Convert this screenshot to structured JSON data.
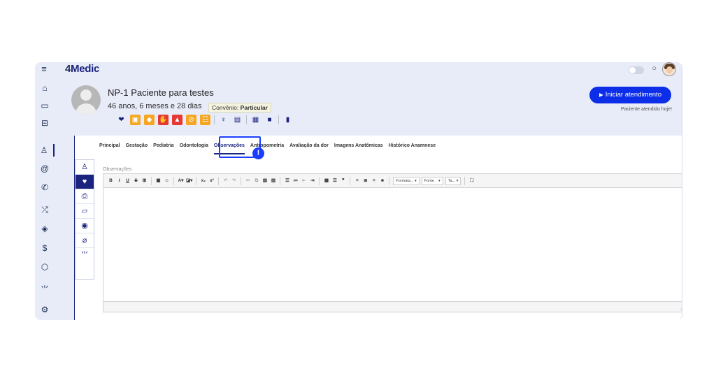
{
  "app": {
    "logo": {
      "four": "4",
      "rest": "Medic"
    }
  },
  "patient": {
    "name": "NP-1 Paciente para testes",
    "age": "46 anos, 6 meses e 28 dias",
    "convenio_label": "Convênio:",
    "convenio_value": "Particular"
  },
  "actions": {
    "start_label": "Iniciar atendimento",
    "attended_today": "Paciente atendido hoje!"
  },
  "tabs": [
    {
      "label": "Principal"
    },
    {
      "label": "Gestação"
    },
    {
      "label": "Pediatria"
    },
    {
      "label": "Odontologia"
    },
    {
      "label": "Observações"
    },
    {
      "label": "Antropometria"
    },
    {
      "label": "Avaliação da dor"
    },
    {
      "label": "Imagens Anatômicas"
    },
    {
      "label": "Histórico Anamnese"
    }
  ],
  "active_tab": "Observações",
  "highlight_marker": "!",
  "editor": {
    "label": "Observações",
    "format_select": "Formata...",
    "font_select": "Fonte",
    "size_select": "Ta...",
    "content": ""
  },
  "colors": {
    "brand_dark": "#1a237e",
    "primary_button": "#0d2ee8",
    "highlight": "#1a3dff",
    "warning_orange": "#f5a623",
    "alert_red": "#e53935"
  }
}
